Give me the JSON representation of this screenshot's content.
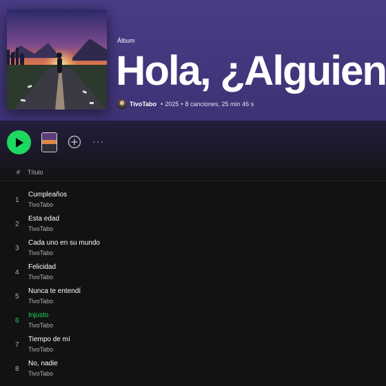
{
  "album": {
    "type_label": "Álbum",
    "title": "Hola, ¿Alguien",
    "artist": "TivoTabo",
    "year": "2025",
    "summary": "8 canciones, 25 min 46 s",
    "separator": "•"
  },
  "controls": {
    "more_label": "···",
    "accent_color": "#1ed760"
  },
  "table": {
    "col_number": "#",
    "col_title": "Título"
  },
  "tracks": [
    {
      "num": "1",
      "title": "Cumpleaños",
      "artist": "TivoTabo"
    },
    {
      "num": "2",
      "title": "Esta edad",
      "artist": "TivoTabo"
    },
    {
      "num": "3",
      "title": "Cada uno en su mundo",
      "artist": "TivoTabo"
    },
    {
      "num": "4",
      "title": "Felicidad",
      "artist": "TivoTabo"
    },
    {
      "num": "5",
      "title": "Nunca te entendí",
      "artist": "TivoTabo"
    },
    {
      "num": "6",
      "title": "Injusto",
      "artist": "TivoTabo",
      "active": true
    },
    {
      "num": "7",
      "title": "Tiempo de mí",
      "artist": "TivoTabo"
    },
    {
      "num": "8",
      "title": "No, nadie",
      "artist": "TivoTabo"
    }
  ]
}
